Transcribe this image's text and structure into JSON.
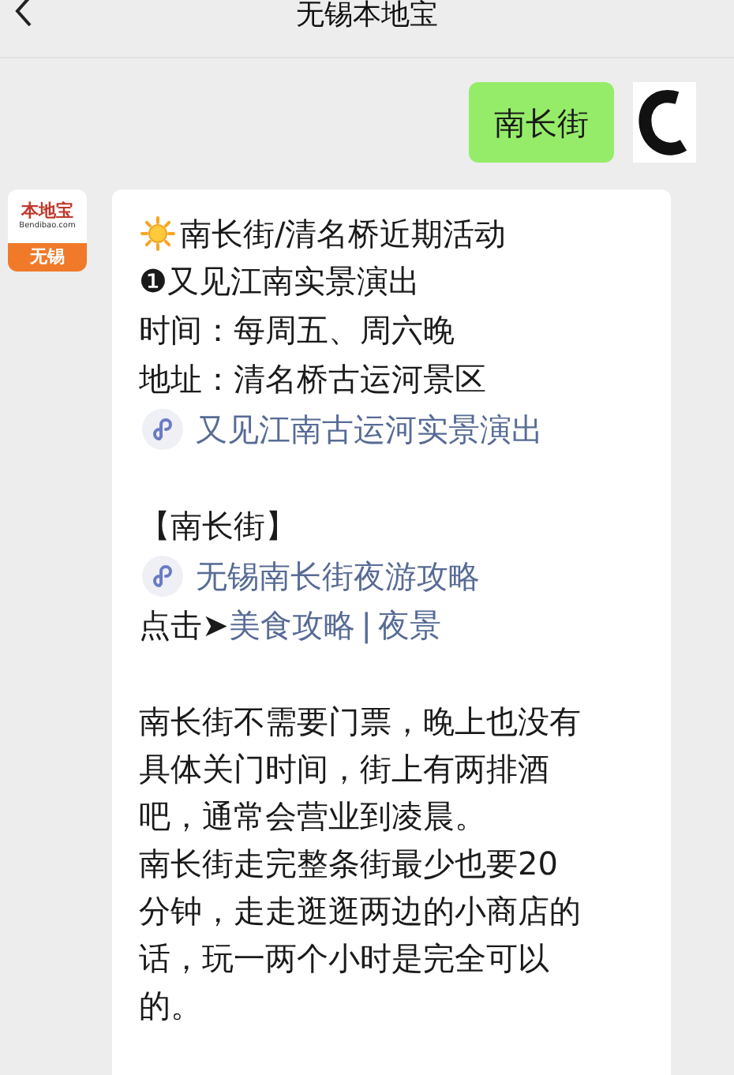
{
  "header": {
    "title": "无锡本地宝"
  },
  "messages": [
    {
      "kind": "outgoing",
      "text": "南长街"
    },
    {
      "kind": "incoming",
      "avatar": {
        "name": "本地宝",
        "site": "Bendibao.com",
        "city": "无锡"
      },
      "lines": [
        {
          "kind": "heading",
          "text": "南长街/清名桥近期活动"
        },
        {
          "kind": "text",
          "text": "❶又见江南实景演出"
        },
        {
          "kind": "text",
          "text": "时间：每周五、周六晚"
        },
        {
          "kind": "text",
          "text": "地址：清名桥古运河景区"
        },
        {
          "kind": "link",
          "text": "又见江南古运河实景演出"
        },
        {
          "kind": "spacer"
        },
        {
          "kind": "text",
          "text": "【南长街】"
        },
        {
          "kind": "link",
          "text": "无锡南长街夜游攻略"
        },
        {
          "kind": "links",
          "prefix": "点击➤",
          "links": [
            "美食攻略",
            "夜景"
          ],
          "separator": "|"
        },
        {
          "kind": "spacer"
        },
        {
          "kind": "paragraph",
          "text": "南长街不需要门票，晚上也没有具体关门时间，街上有两排酒吧，通常会营业到凌晨。"
        },
        {
          "kind": "paragraph",
          "text": "南长街走完整条街最少也要20分钟，走走逛逛两边的小商店的话，玩一两个小时是完全可以的。"
        }
      ]
    }
  ]
}
